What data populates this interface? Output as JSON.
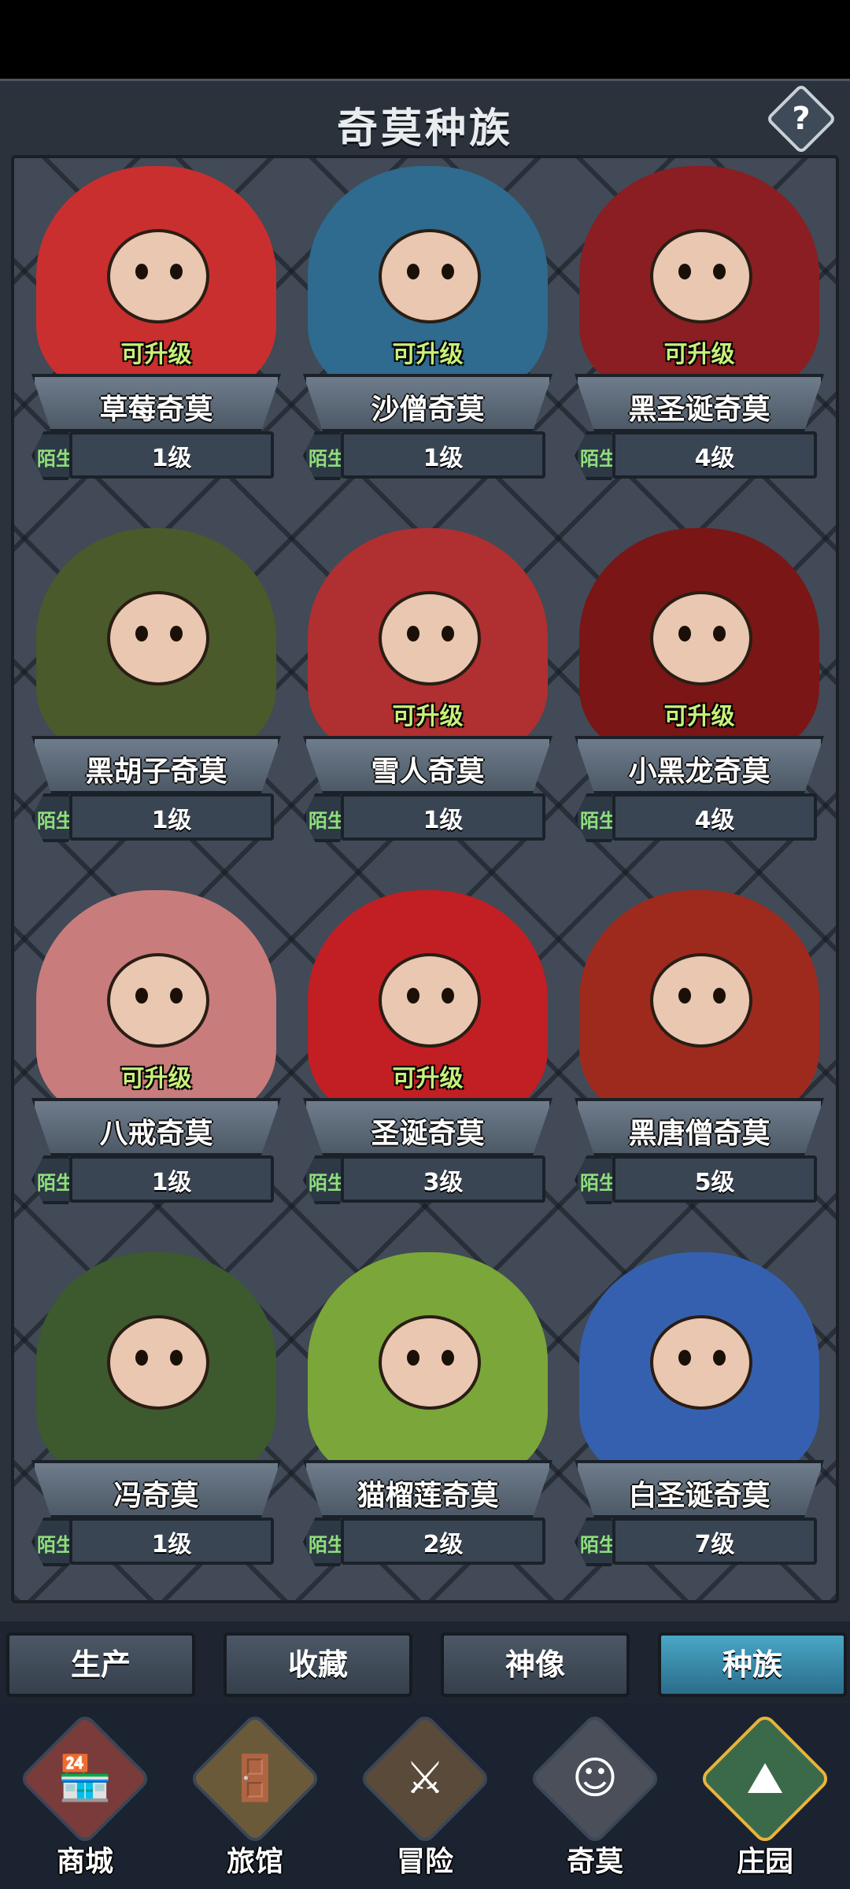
{
  "panel": {
    "title": "奇莫种族",
    "help_label": "?"
  },
  "cards": [
    {
      "name": "草莓奇莫",
      "level": "1级",
      "relation": "陌生",
      "upgrade": "可升级",
      "color": "#c92f2f"
    },
    {
      "name": "沙僧奇莫",
      "level": "1级",
      "relation": "陌生",
      "upgrade": "可升级",
      "color": "#2f6a8f"
    },
    {
      "name": "黑圣诞奇莫",
      "level": "4级",
      "relation": "陌生",
      "upgrade": "可升级",
      "color": "#8a1e22"
    },
    {
      "name": "黑胡子奇莫",
      "level": "1级",
      "relation": "陌生",
      "upgrade": "",
      "color": "#4a5a2a"
    },
    {
      "name": "雪人奇莫",
      "level": "1级",
      "relation": "陌生",
      "upgrade": "可升级",
      "color": "#b02f30"
    },
    {
      "name": "小黑龙奇莫",
      "level": "4级",
      "relation": "陌生",
      "upgrade": "可升级",
      "color": "#7a1616"
    },
    {
      "name": "八戒奇莫",
      "level": "1级",
      "relation": "陌生",
      "upgrade": "可升级",
      "color": "#c97c7c"
    },
    {
      "name": "圣诞奇莫",
      "level": "3级",
      "relation": "陌生",
      "upgrade": "可升级",
      "color": "#c11f24"
    },
    {
      "name": "黑唐僧奇莫",
      "level": "5级",
      "relation": "陌生",
      "upgrade": "",
      "color": "#9e2a1e"
    },
    {
      "name": "冯奇莫",
      "level": "1级",
      "relation": "陌生",
      "upgrade": "",
      "color": "#3c5a2e"
    },
    {
      "name": "猫榴莲奇莫",
      "level": "2级",
      "relation": "陌生",
      "upgrade": "",
      "color": "#7aa63a"
    },
    {
      "name": "白圣诞奇莫",
      "level": "7级",
      "relation": "陌生",
      "upgrade": "",
      "color": "#3560b0"
    }
  ],
  "tabs": [
    {
      "label": "生产"
    },
    {
      "label": "收藏"
    },
    {
      "label": "神像"
    },
    {
      "label": "种族"
    }
  ],
  "nav": [
    {
      "label": "商城",
      "icon": "shop-icon",
      "glyph": "🏪",
      "color": "#7a3b3b"
    },
    {
      "label": "旅馆",
      "icon": "inn-gate-icon",
      "glyph": "🚪",
      "color": "#6b5a3a"
    },
    {
      "label": "冒险",
      "icon": "crossed-swords-icon",
      "glyph": "⚔",
      "color": "#5a4a3a"
    },
    {
      "label": "奇莫",
      "icon": "chimo-avatar-icon",
      "glyph": "☺",
      "color": "#4a4f5a"
    },
    {
      "label": "庄园",
      "icon": "manor-island-icon",
      "glyph": "⛰",
      "color": "#3a6a4a"
    }
  ]
}
